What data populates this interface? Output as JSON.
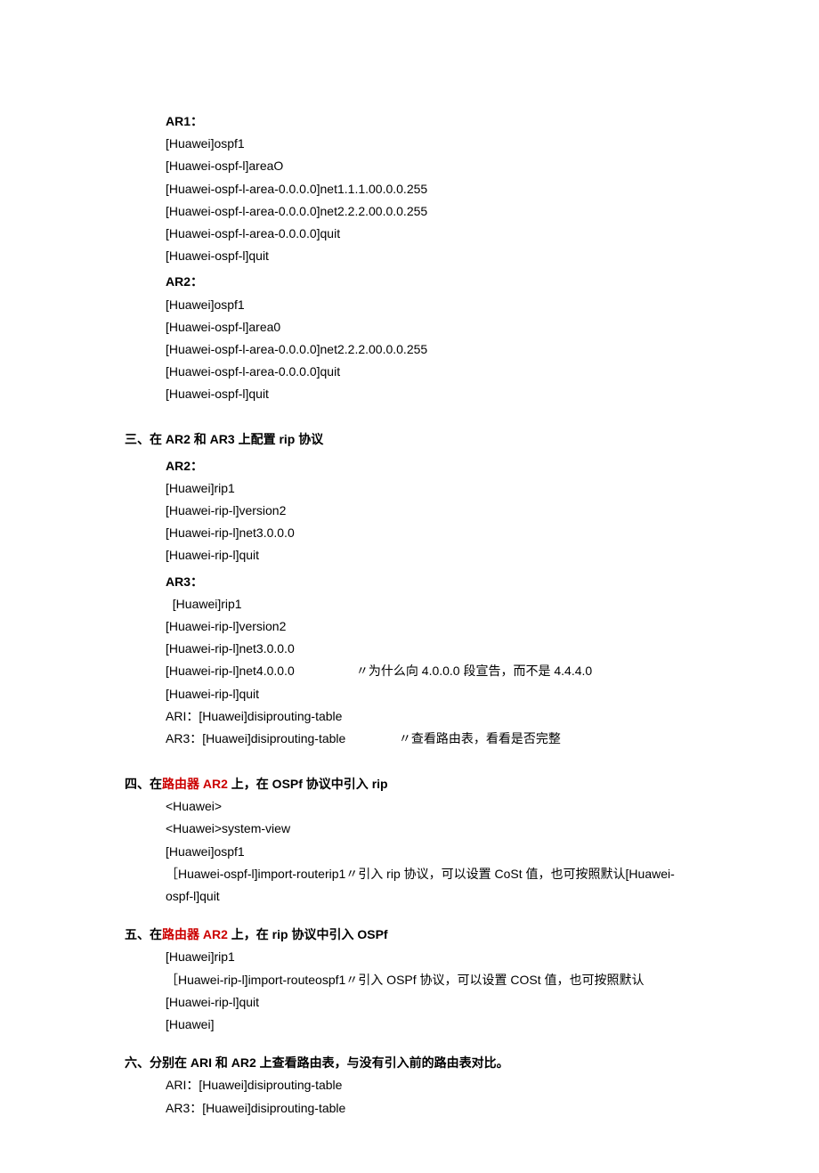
{
  "section1": {
    "ar1_label": "AR1：",
    "ar1_lines": [
      "[Huawei]ospf1",
      "[Huawei-ospf-l]areaO",
      "[Huawei-ospf-l-area-0.0.0.0]net1.1.1.00.0.0.255",
      "[Huawei-ospf-l-area-0.0.0.0]net2.2.2.00.0.0.255",
      "[Huawei-ospf-l-area-0.0.0.0]quit",
      "[Huawei-ospf-l]quit"
    ],
    "ar2_label": "AR2：",
    "ar2_lines": [
      "[Huawei]ospf1",
      "[Huawei-ospf-l]area0",
      "[Huawei-ospf-l-area-0.0.0.0]net2.2.2.00.0.0.255",
      "[Huawei-ospf-l-area-0.0.0.0]quit",
      "[Huawei-ospf-l]quit"
    ]
  },
  "section3": {
    "heading": "三、在 AR2 和 AR3 上配置 rip 协议",
    "ar2_label": "AR2：",
    "ar2_lines": [
      "[Huawei]rip1",
      "[Huawei-rip-l]version2",
      "[Huawei-rip-l]net3.0.0.0",
      "[Huawei-rip-l]quit"
    ],
    "ar3_label": "AR3：",
    "ar3_lines": [
      "  [Huawei]rip1",
      "[Huawei-rip-l]version2",
      "[Huawei-rip-l]net3.0.0.0"
    ],
    "ar3_net4_cmd": "[Huawei-rip-l]net4.0.0.0",
    "ar3_net4_note": "〃为什么向 4.0.0.0 段宣告，而不是 4.4.4.0",
    "ar3_quit": "[Huawei-rip-l]quit",
    "check_ari": "ARI：[Huawei]disiprouting-table",
    "check_ar3_cmd": "AR3：[Huawei]disiprouting-table",
    "check_ar3_note": "〃查看路由表，看看是否完整"
  },
  "section4": {
    "heading_prefix": "四、在",
    "heading_red": "路由器 AR2",
    "heading_suffix": " 上，在 OSPf 协议中引入 rip",
    "lines": [
      "<Huawei>",
      "<Huawei>system-view",
      "[Huawei]ospf1"
    ],
    "import_line": "［Huawei-ospf-l]import-routerip1〃引入 rip 协议，可以设置 CoSt 值，也可按照默认[Huawei-ospf-l]quit"
  },
  "section5": {
    "heading_prefix": "五、在",
    "heading_red": "路由器 AR2",
    "heading_suffix": " 上，在 rip 协议中引入 OSPf",
    "lines": [
      "[Huawei]rip1",
      "［Huawei-rip-l]import-routeospf1〃引入 OSPf 协议，可以设置 COSt 值，也可按照默认",
      "[Huawei-rip-l]quit",
      "[Huawei]"
    ]
  },
  "section6": {
    "heading": "六、分别在 ARI 和 AR2 上查看路由表，与没有引入前的路由表对比。",
    "lines": [
      "ARI：[Huawei]disiprouting-table",
      "AR3：[Huawei]disiprouting-table"
    ]
  }
}
